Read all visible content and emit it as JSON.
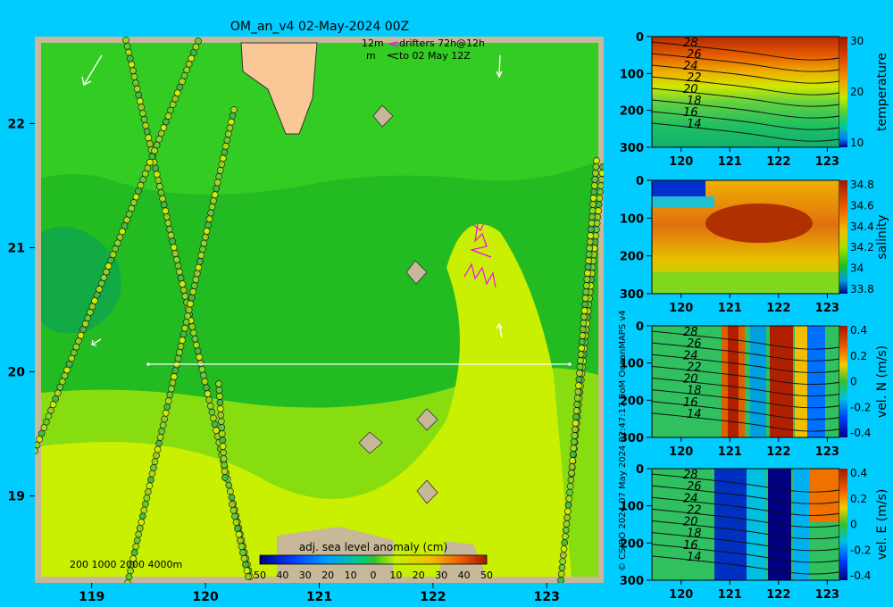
{
  "title": "OM_an_v4  02-May-2024 00Z",
  "legend_text": {
    "line1_prefix": "12m",
    "line1_suffix": "drifters 72h@12h",
    "line2_prefix": "m",
    "line2_suffix": "to 02 May 12Z"
  },
  "isobath_label": "200  1000  2000  4000m",
  "credit": "© CSIRO 2024   07 May 2024 22:47:17 BoM OceanMAPS v4",
  "colors": {
    "background": "#00ccff",
    "land": "#f9c896",
    "land_border": "#c8b89a",
    "drifter": "#ff00ff"
  },
  "chart_data": [
    {
      "id": "map",
      "type": "heatmap",
      "title": "OM_an_v4  02-May-2024 00Z",
      "xlim": [
        118.5,
        123.5
      ],
      "ylim": [
        18.3,
        22.7
      ],
      "x_ticks": [
        "119",
        "120",
        "121",
        "122",
        "123"
      ],
      "y_ticks": [
        "19",
        "20",
        "21",
        "22"
      ],
      "colorbar": {
        "label": "adj. sea level anomaly (cm)",
        "ticks": [
          "50",
          "40",
          "30",
          "20",
          "10",
          "0",
          "10",
          "20",
          "30",
          "40",
          "50"
        ],
        "range": [
          -50,
          50
        ]
      },
      "section_line": {
        "lat": 20,
        "lon_start": 119.5,
        "lon_end": 123.2
      }
    },
    {
      "id": "temperature",
      "type": "heatmap",
      "colorbar_label": "temperature",
      "colorbar_ticks": [
        "30",
        "20",
        "10"
      ],
      "x_ticks": [
        "120",
        "121",
        "122",
        "123"
      ],
      "y_ticks": [
        "0",
        "100",
        "200",
        "300"
      ],
      "contour_labels": [
        "28",
        "26",
        "24",
        "22",
        "20",
        "18",
        "16",
        "14"
      ]
    },
    {
      "id": "salinity",
      "type": "heatmap",
      "colorbar_label": "salinity",
      "colorbar_ticks": [
        "34.8",
        "34.6",
        "34.4",
        "34.2",
        "34",
        "33.8"
      ],
      "x_ticks": [
        "120",
        "121",
        "122",
        "123"
      ],
      "y_ticks": [
        "0",
        "100",
        "200",
        "300"
      ]
    },
    {
      "id": "velN",
      "type": "heatmap",
      "colorbar_label": "vel. N (m/s)",
      "colorbar_ticks": [
        "0.4",
        "0.2",
        "0",
        "-0.2",
        "-0.4"
      ],
      "x_ticks": [
        "120",
        "121",
        "122",
        "123"
      ],
      "y_ticks": [
        "0",
        "100",
        "200",
        "300"
      ],
      "contour_labels": [
        "28",
        "26",
        "24",
        "22",
        "20",
        "18",
        "16",
        "14"
      ]
    },
    {
      "id": "velE",
      "type": "heatmap",
      "colorbar_label": "vel. E (m/s)",
      "colorbar_ticks": [
        "0.4",
        "0.2",
        "0",
        "-0.2",
        "-0.4"
      ],
      "x_ticks": [
        "120",
        "121",
        "122",
        "123"
      ],
      "y_ticks": [
        "0",
        "100",
        "200",
        "300"
      ],
      "contour_labels": [
        "28",
        "26",
        "24",
        "22",
        "20",
        "18",
        "16",
        "14"
      ]
    }
  ]
}
